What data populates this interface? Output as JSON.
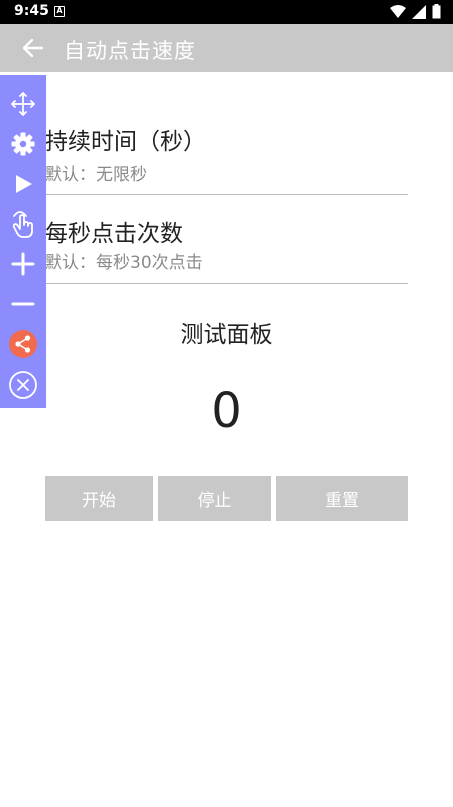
{
  "status_bar": {
    "time": "9:45",
    "notification_icon": "A"
  },
  "app_bar": {
    "back_icon": "arrow-left",
    "title": "自动点击速度"
  },
  "settings": [
    {
      "title": "持续时间（秒）",
      "subtitle": "默认：无限秒"
    },
    {
      "title": "每秒点击次数",
      "subtitle": "默认：每秒30次点击"
    }
  ],
  "test_panel": {
    "title": "测试面板",
    "counter": "0",
    "buttons": {
      "start": "开始",
      "stop": "停止",
      "reset": "重置"
    }
  },
  "floating_toolbar": {
    "background": "#8c8cff",
    "tools": [
      "move-icon",
      "gear-icon",
      "play-icon",
      "tap-hand-icon",
      "plus-icon",
      "minus-icon",
      "share-icon",
      "close-circle-icon"
    ],
    "share_color": "#f26b4f"
  },
  "colors": {
    "app_bar": "#c8c8c8",
    "button": "#c8c8c8"
  }
}
